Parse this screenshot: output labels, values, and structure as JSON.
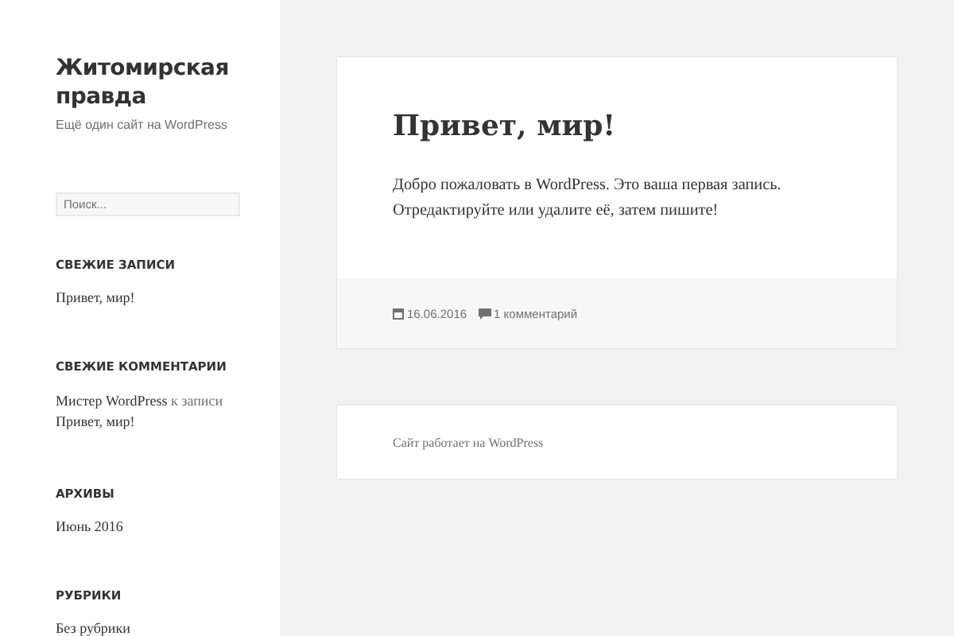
{
  "site": {
    "title": "Житомирская правда",
    "tagline": "Ещё один сайт на WordPress"
  },
  "search": {
    "placeholder": "Поиск..."
  },
  "widgets": [
    {
      "kind": "links",
      "title": "СВЕЖИЕ ЗАПИСИ",
      "items": [
        "Привет, мир!"
      ]
    },
    {
      "kind": "comments",
      "title": "СВЕЖИЕ КОММЕНТАРИИ",
      "comments": [
        {
          "author": "Мистер WordPress",
          "connector": "к записи",
          "post": "Привет, мир!"
        }
      ]
    },
    {
      "kind": "links",
      "title": "АРХИВЫ",
      "items": [
        "Июнь 2016"
      ]
    },
    {
      "kind": "links",
      "title": "РУБРИКИ",
      "items": [
        "Без рубрики"
      ]
    }
  ],
  "post": {
    "title": "Привет, мир!",
    "body": "Добро пожаловать в WordPress. Это ваша первая запись. Отредактируйте или удалите её, затем пишите!",
    "date": "16.06.2016",
    "comments": "1 комментарий"
  },
  "footer": {
    "credit": "Сайт работает на WordPress"
  }
}
